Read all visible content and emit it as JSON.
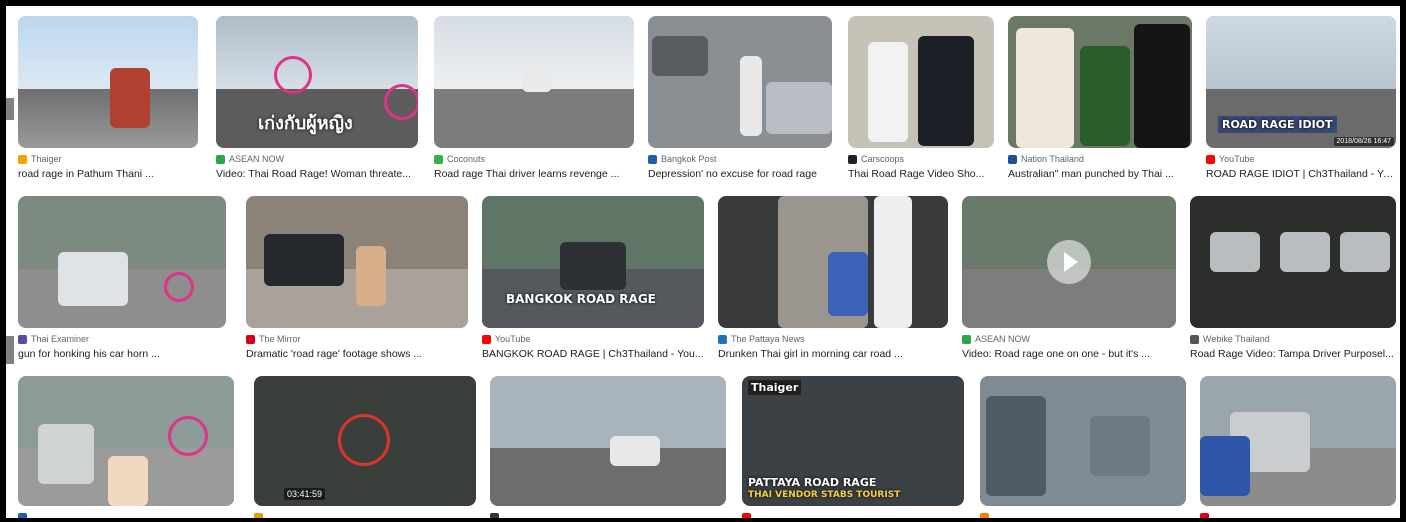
{
  "results": [
    {
      "source": "Thaiger",
      "caption": "road rage in Pathum Thani ...",
      "fav": "#f0a500"
    },
    {
      "source": "ASEAN NOW",
      "caption": "Video: Thai Road Rage! Woman threate...",
      "fav": "#2aa84a",
      "overlay": "เก่งกับผู้หญิง"
    },
    {
      "source": "Coconuts",
      "caption": "Road rage Thai driver learns revenge ...",
      "fav": "#33b24a"
    },
    {
      "source": "Bangkok Post",
      "caption": "Depression' no excuse for road rage",
      "fav": "#1f5fb0"
    },
    {
      "source": "Carscoops",
      "caption": "Thai Road Rage Video Sho...",
      "fav": "#222222"
    },
    {
      "source": "Nation Thailand",
      "caption": "Australian\" man punched by Thai ...",
      "fav": "#1a4f9c"
    },
    {
      "source": "YouTube",
      "caption": "ROAD RAGE IDIOT | Ch3Thailand - You...",
      "fav": "#ff0000",
      "overlay": "ROAD RAGE IDIOT",
      "stamp": "2018/08/26 16:47"
    },
    {
      "source": "Thai Examiner",
      "caption": "gun for honking his car horn ...",
      "fav": "#5b4aa8"
    },
    {
      "source": "The Mirror",
      "caption": "Dramatic 'road rage' footage shows ...",
      "fav": "#d6001c"
    },
    {
      "source": "YouTube",
      "caption": "BANGKOK ROAD RAGE | Ch3Thailand - You...",
      "fav": "#ff0000",
      "overlay": "BANGKOK ROAD RAGE"
    },
    {
      "source": "The Pattaya News",
      "caption": "Drunken Thai girl in morning car road ...",
      "fav": "#1e73be"
    },
    {
      "source": "ASEAN NOW",
      "caption": "Video: Road rage one on one - but it's ...",
      "fav": "#2aa84a"
    },
    {
      "source": "Webike Thailand",
      "caption": "Road Rage Video: Tampa Driver Purposel...",
      "fav": "#555555"
    },
    {
      "fav": "#1f5fb0"
    },
    {
      "fav": "#e0a000",
      "stamp": "03:41:59"
    },
    {
      "fav": "#333333"
    },
    {
      "fav": "#ff0000",
      "brand": "Thaiger",
      "overlay": "PATTAYA ROAD RAGE",
      "overlay2": "THAI VENDOR STABS TOURIST"
    },
    {
      "fav": "#ff7a00"
    },
    {
      "fav": "#d6001c"
    }
  ]
}
